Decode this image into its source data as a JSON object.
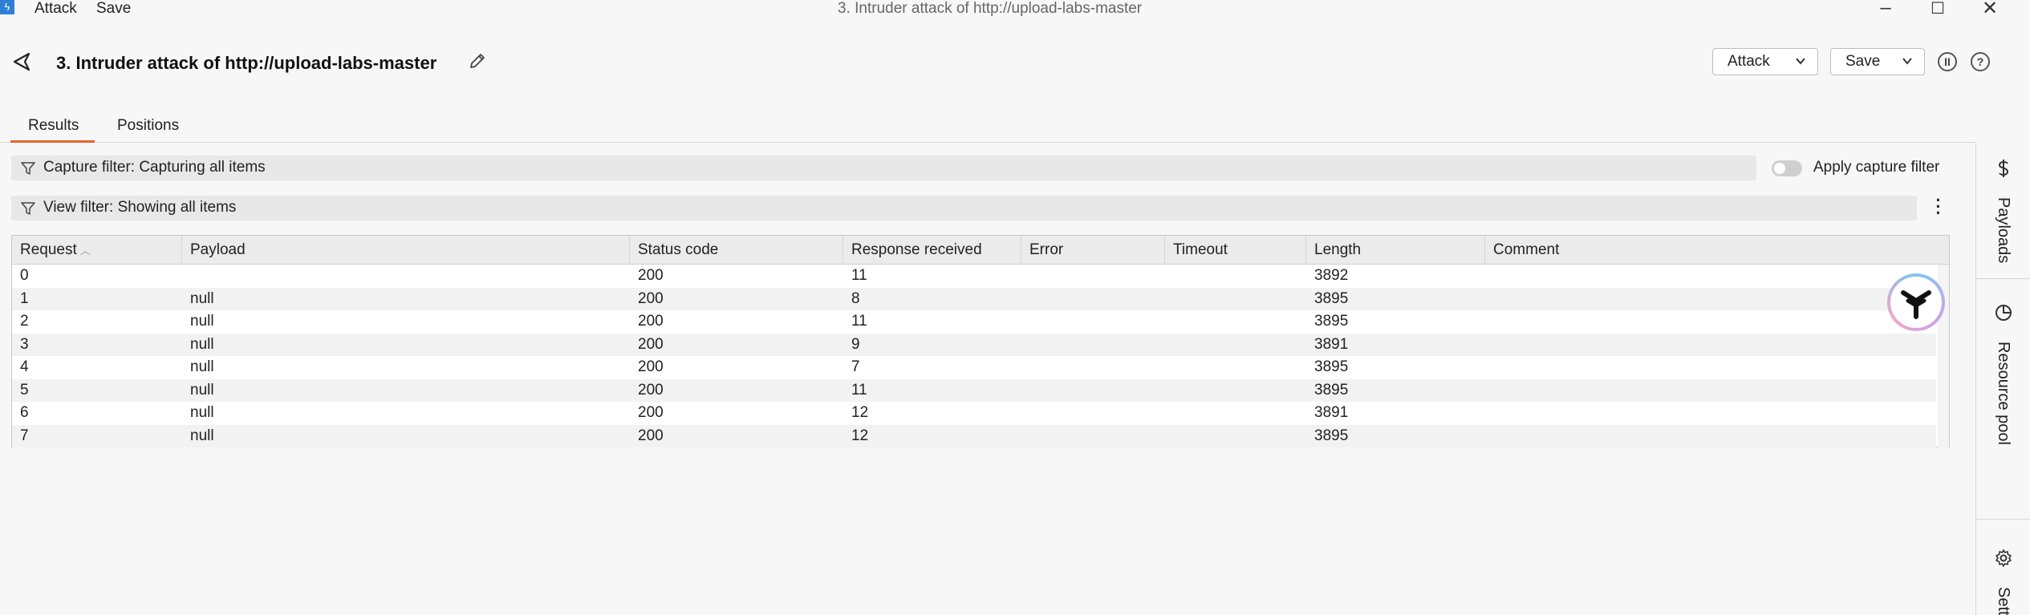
{
  "titlebar": {
    "menu": [
      "Attack",
      "Save"
    ],
    "window_title": "3. Intruder attack of http://upload-labs-master"
  },
  "header": {
    "title": "3. Intruder attack of http://upload-labs-master",
    "attack_button": "Attack",
    "save_button": "Save"
  },
  "tabs": [
    "Results",
    "Positions"
  ],
  "capture_filter": {
    "text": "Capture filter: Capturing all items",
    "toggle_label": "Apply capture filter",
    "toggle_on": false
  },
  "view_filter": {
    "text": "View filter: Showing all items"
  },
  "table": {
    "columns": [
      "Request",
      "Payload",
      "Status code",
      "Response received",
      "Error",
      "Timeout",
      "Length",
      "Comment"
    ],
    "sorted_column": "Request",
    "rows": [
      [
        "0",
        "",
        "200",
        "11",
        "",
        "",
        "3892",
        ""
      ],
      [
        "1",
        "null",
        "200",
        "8",
        "",
        "",
        "3895",
        ""
      ],
      [
        "2",
        "null",
        "200",
        "11",
        "",
        "",
        "3895",
        ""
      ],
      [
        "3",
        "null",
        "200",
        "9",
        "",
        "",
        "3891",
        ""
      ],
      [
        "4",
        "null",
        "200",
        "7",
        "",
        "",
        "3895",
        ""
      ],
      [
        "5",
        "null",
        "200",
        "11",
        "",
        "",
        "3895",
        ""
      ],
      [
        "6",
        "null",
        "200",
        "12",
        "",
        "",
        "3891",
        ""
      ],
      [
        "7",
        "null",
        "200",
        "12",
        "",
        "",
        "3895",
        ""
      ]
    ]
  },
  "sidebar": {
    "items": [
      {
        "label": "Payloads",
        "icon": "dollar-icon"
      },
      {
        "label": "Resource pool",
        "icon": "pie-chart-icon"
      },
      {
        "label": "Settin",
        "icon": "gear-icon"
      }
    ]
  },
  "colors": {
    "accent": "#e8632b",
    "background": "#f7f7f7",
    "header_row": "#ebebeb",
    "row_stripe": "#f2f2f2"
  }
}
